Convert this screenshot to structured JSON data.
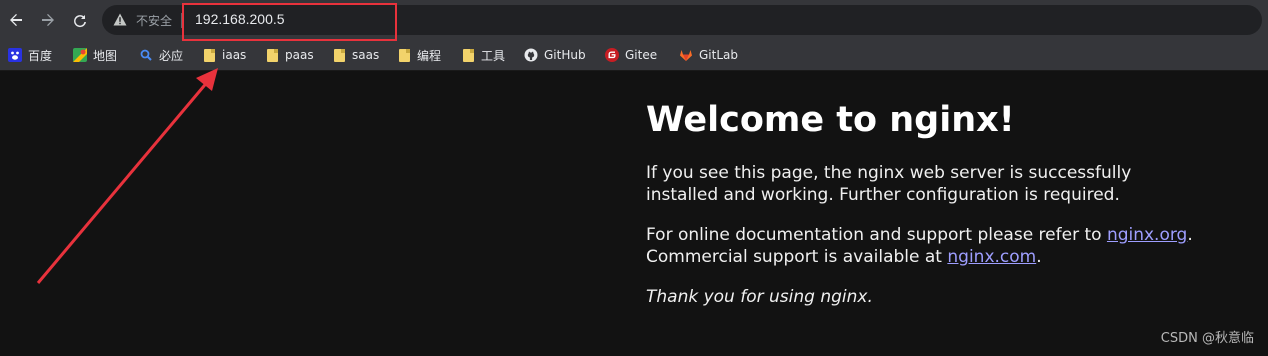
{
  "toolbar": {
    "security_label": "不安全",
    "url": "192.168.200.5",
    "icons": [
      "back-icon",
      "forward-icon",
      "reload-icon",
      "warning-icon"
    ]
  },
  "bookmarks": [
    {
      "label": "百度",
      "icon": "baidu-icon"
    },
    {
      "label": "地图",
      "icon": "maps-icon"
    },
    {
      "label": "必应",
      "icon": "bing-icon"
    },
    {
      "label": "iaas",
      "icon": "folder-icon"
    },
    {
      "label": "paas",
      "icon": "folder-icon"
    },
    {
      "label": "saas",
      "icon": "folder-icon"
    },
    {
      "label": "编程",
      "icon": "folder-icon"
    },
    {
      "label": "工具",
      "icon": "folder-icon"
    },
    {
      "label": "GitHub",
      "icon": "github-icon"
    },
    {
      "label": "Gitee",
      "icon": "gitee-icon"
    },
    {
      "label": "GitLab",
      "icon": "gitlab-icon"
    }
  ],
  "page": {
    "title": "Welcome to nginx!",
    "p1": "If you see this page, the nginx web server is successfully installed and working. Further configuration is required.",
    "p2_prefix": "For online documentation and support please refer to ",
    "link1": "nginx.org",
    "p2_mid": ". Commercial support is available at ",
    "link2": "nginx.com",
    "p2_suffix": ".",
    "p3": "Thank you for using nginx."
  },
  "watermark": "CSDN @秋意临",
  "colors": {
    "annotation": "#e8323c",
    "link": "#9e9eff",
    "background": "#121212",
    "toolbar": "#35363a"
  }
}
